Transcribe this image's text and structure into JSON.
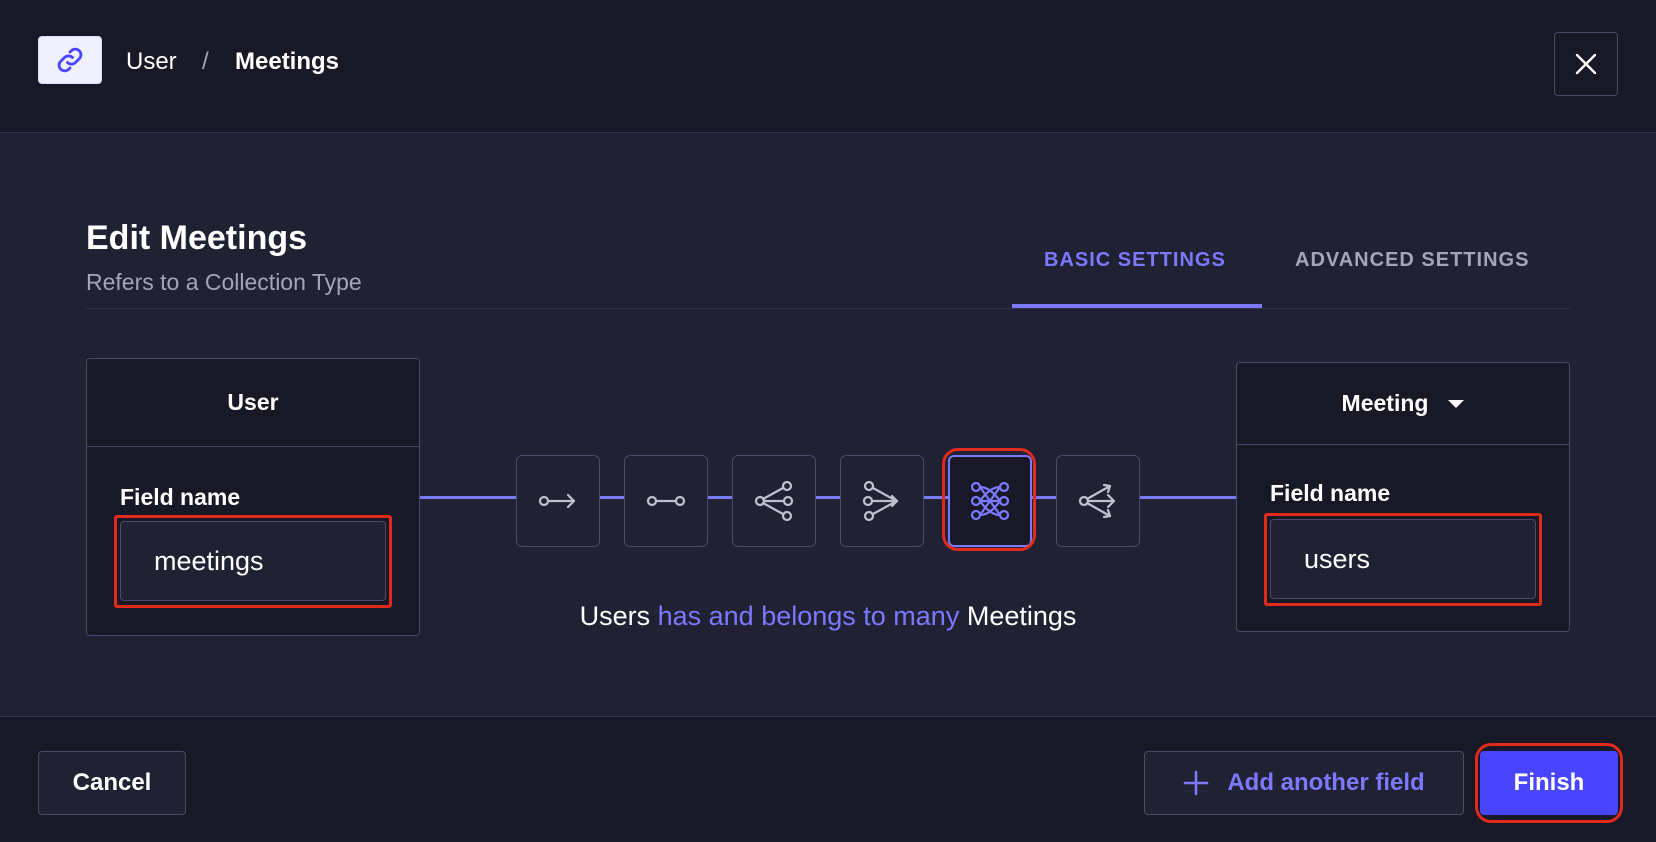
{
  "header": {
    "breadcrumb": {
      "parent": "User",
      "separator": "/",
      "current": "Meetings"
    },
    "link_icon": "link-icon",
    "close_icon": "close-icon"
  },
  "main": {
    "title": "Edit Meetings",
    "subtitle": "Refers to a Collection Type",
    "tabs": [
      {
        "label": "BASIC SETTINGS",
        "active": true
      },
      {
        "label": "ADVANCED SETTINGS",
        "active": false
      }
    ],
    "left_box": {
      "name": "User",
      "field_label": "Field name",
      "field_value": "meetings"
    },
    "right_box": {
      "name": "Meeting",
      "field_label": "Field name",
      "field_value": "users"
    },
    "relations": [
      {
        "icon": "one-way-icon",
        "active": false
      },
      {
        "icon": "one-to-one-icon",
        "active": false
      },
      {
        "icon": "one-to-many-icon",
        "active": false
      },
      {
        "icon": "many-to-one-icon",
        "active": false
      },
      {
        "icon": "many-to-many-icon",
        "active": true
      },
      {
        "icon": "many-way-icon",
        "active": false
      }
    ],
    "sentence": {
      "subject": "Users",
      "relation": "has and belongs to many",
      "object": "Meetings"
    }
  },
  "footer": {
    "cancel_label": "Cancel",
    "add_label": "Add another field",
    "finish_label": "Finish"
  },
  "colors": {
    "accent": "#7b79ff",
    "primary_button": "#4945ff",
    "highlight": "#e02a1b",
    "background": "#212134",
    "header_background": "#181826"
  }
}
